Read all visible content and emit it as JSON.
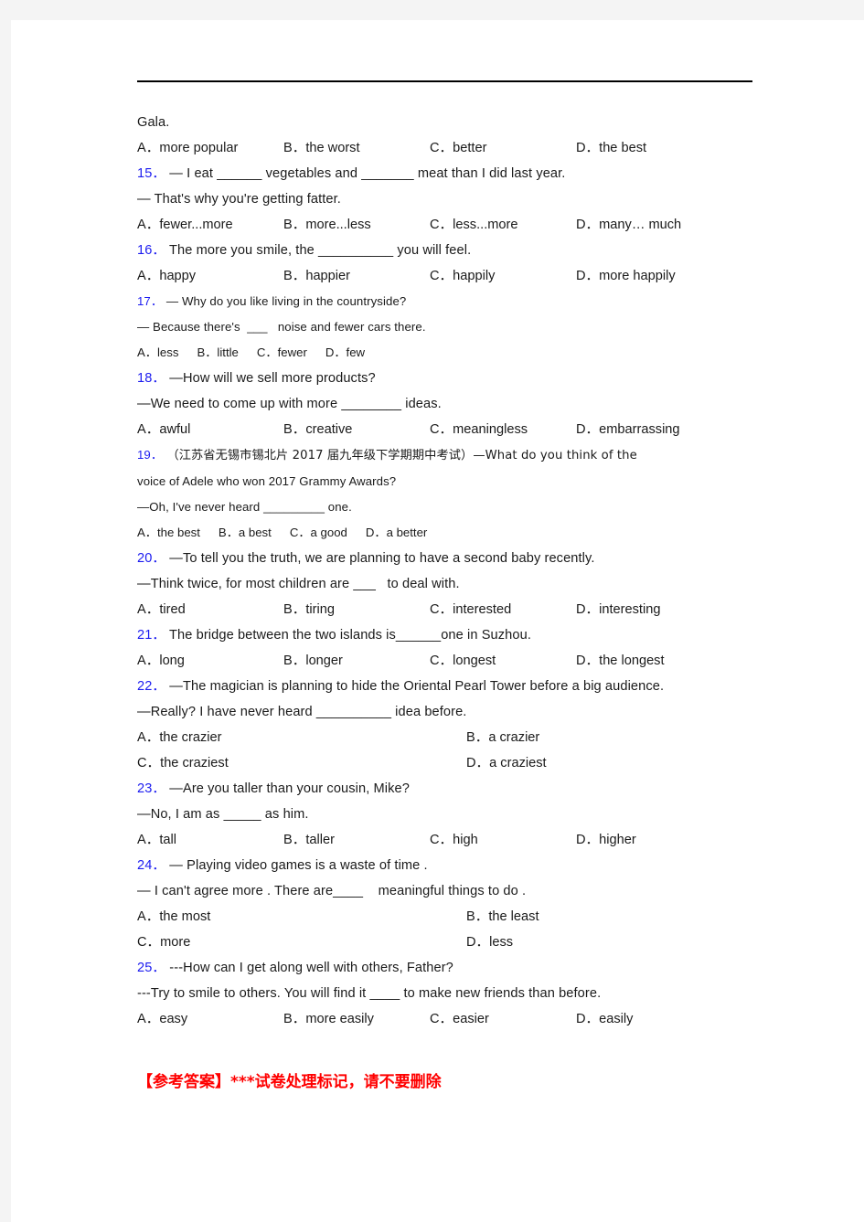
{
  "page": {
    "background_color": "#f4f4f4",
    "paper_color": "#ffffff",
    "question_number_color": "#1c1cf0",
    "body_text_color": "#1a1a1a",
    "answer_mark_color": "#ff0000"
  },
  "fragment": {
    "carryover_text": "Gala.",
    "carryover_options": {
      "a": "A．more popular",
      "b": "B．the worst",
      "c": "C．better",
      "d": "D．the best"
    }
  },
  "questions": [
    {
      "number": "15．",
      "stem_lines": [
        "— I eat ______ vegetables and _______ meat than I did last year.",
        "— That's why you're getting fatter."
      ],
      "options": [
        "A．fewer...more",
        "B．more...less",
        "C．less...more",
        "D．many… much"
      ],
      "layout": "grid4",
      "size": "normal"
    },
    {
      "number": "16．",
      "stem_lines": [
        "The more you smile, the __________ you will feel."
      ],
      "options": [
        "A．happy",
        "B．happier",
        "C．happily",
        "D．more happily"
      ],
      "layout": "grid4",
      "size": "normal"
    },
    {
      "number": "17．",
      "stem_lines": [
        "— Why do you like living in the countryside?",
        "— Because there's  ___   noise and fewer cars there."
      ],
      "options": [
        "A．less",
        "B．little",
        "C．fewer",
        "D．few"
      ],
      "layout": "inline",
      "size": "small"
    },
    {
      "number": "18．",
      "stem_lines": [
        "—How will we sell more products?",
        "—We need to come up with more ________ ideas."
      ],
      "options": [
        "A．awful",
        "B．creative",
        "C．meaningless",
        "D．embarrassing"
      ],
      "layout": "grid4",
      "size": "normal"
    },
    {
      "number": "19．",
      "stem_lines": [
        "（江苏省无锡市锡北片 2017 届九年级下学期期中考试）—What do you think of the",
        "voice of Adele who won 2017 Grammy Awards?",
        "—Oh, I've never heard _________ one."
      ],
      "options": [
        "A．the best",
        "B．a best",
        "C．a good",
        "D．a better"
      ],
      "layout": "inline",
      "size": "small"
    },
    {
      "number": "20．",
      "stem_lines": [
        "—To tell you the truth, we are planning to have a second baby recently.",
        "—Think twice, for most children are ___   to deal with."
      ],
      "options": [
        "A．tired",
        "B．tiring",
        "C．interested",
        "D．interesting"
      ],
      "layout": "grid4",
      "size": "normal"
    },
    {
      "number": "21．",
      "stem_lines": [
        "The bridge between the two islands is______one in Suzhou."
      ],
      "options": [
        "A．long",
        "B．longer",
        "C．longest",
        "D．the longest"
      ],
      "layout": "grid4",
      "size": "normal"
    },
    {
      "number": "22．",
      "stem_lines": [
        "—The magician is planning to hide the Oriental Pearl Tower before a big audience.",
        "—Really? I have never heard __________ idea before."
      ],
      "options": [
        "A．the crazier",
        "B．a crazier",
        "C．the craziest",
        "D．a craziest"
      ],
      "layout": "grid2",
      "size": "normal"
    },
    {
      "number": "23．",
      "stem_lines": [
        "—Are you taller than your cousin, Mike?",
        "—No, I am as _____ as him."
      ],
      "options": [
        "A．tall",
        "B．taller",
        "C．high",
        "D．higher"
      ],
      "layout": "grid4",
      "size": "normal"
    },
    {
      "number": "24．",
      "stem_lines": [
        "— Playing video games is a waste of time .",
        "— I can't agree more . There are____    meaningful things to do ."
      ],
      "options": [
        "A．the most",
        "B．the least",
        "C．more",
        "D．less"
      ],
      "layout": "grid2",
      "size": "normal"
    },
    {
      "number": "25．",
      "stem_lines": [
        "---How can I get along well with others, Father?",
        "---Try to smile to others. You will find it ____ to make new friends than before."
      ],
      "options": [
        "A．easy",
        "B．more easily",
        "C．easier",
        "D．easily"
      ],
      "layout": "grid4",
      "size": "normal"
    }
  ],
  "answer_mark": {
    "text": "【参考答案】***试卷处理标记，请不要删除"
  }
}
